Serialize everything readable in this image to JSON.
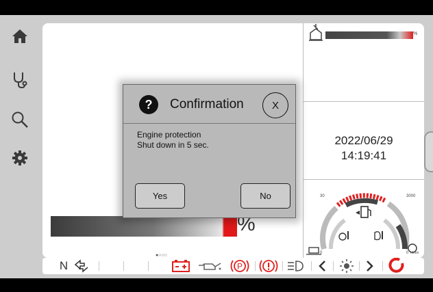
{
  "nav": {
    "items": [
      {
        "name": "home",
        "icon": "home-icon"
      },
      {
        "name": "diagnostics",
        "icon": "stethoscope-icon"
      },
      {
        "name": "search",
        "icon": "search-icon"
      },
      {
        "name": "settings",
        "icon": "gear-icon"
      }
    ]
  },
  "status": {
    "fuel_unit": "%",
    "fuel_level_fraction": 0.97,
    "date": "2022/06/29",
    "time": "14:19:41"
  },
  "gauge": {
    "min_label": "30",
    "max_label": "3000",
    "left_zero": "0",
    "right_zero": "0",
    "rpm_unit": "n/min",
    "warning_color": "#e02020"
  },
  "load": {
    "unit": "%",
    "page_indicator": "●○○○"
  },
  "dialog": {
    "title": "Confirmation",
    "close_label": "X",
    "message_line1": "Engine protection",
    "message_line2": "Shut down in 5 sec.",
    "yes_label": "Yes",
    "no_label": "No"
  },
  "bottom_bar": {
    "gear_label": "N",
    "icons": [
      "direction-arrows-icon",
      "battery-warning-icon",
      "oil-pressure-icon",
      "parking-brake-icon",
      "general-warning-icon",
      "headlight-icon",
      "chevron-left-icon",
      "brightness-icon",
      "chevron-right-icon",
      "power-icon"
    ],
    "warning_color": "#e0201e"
  }
}
